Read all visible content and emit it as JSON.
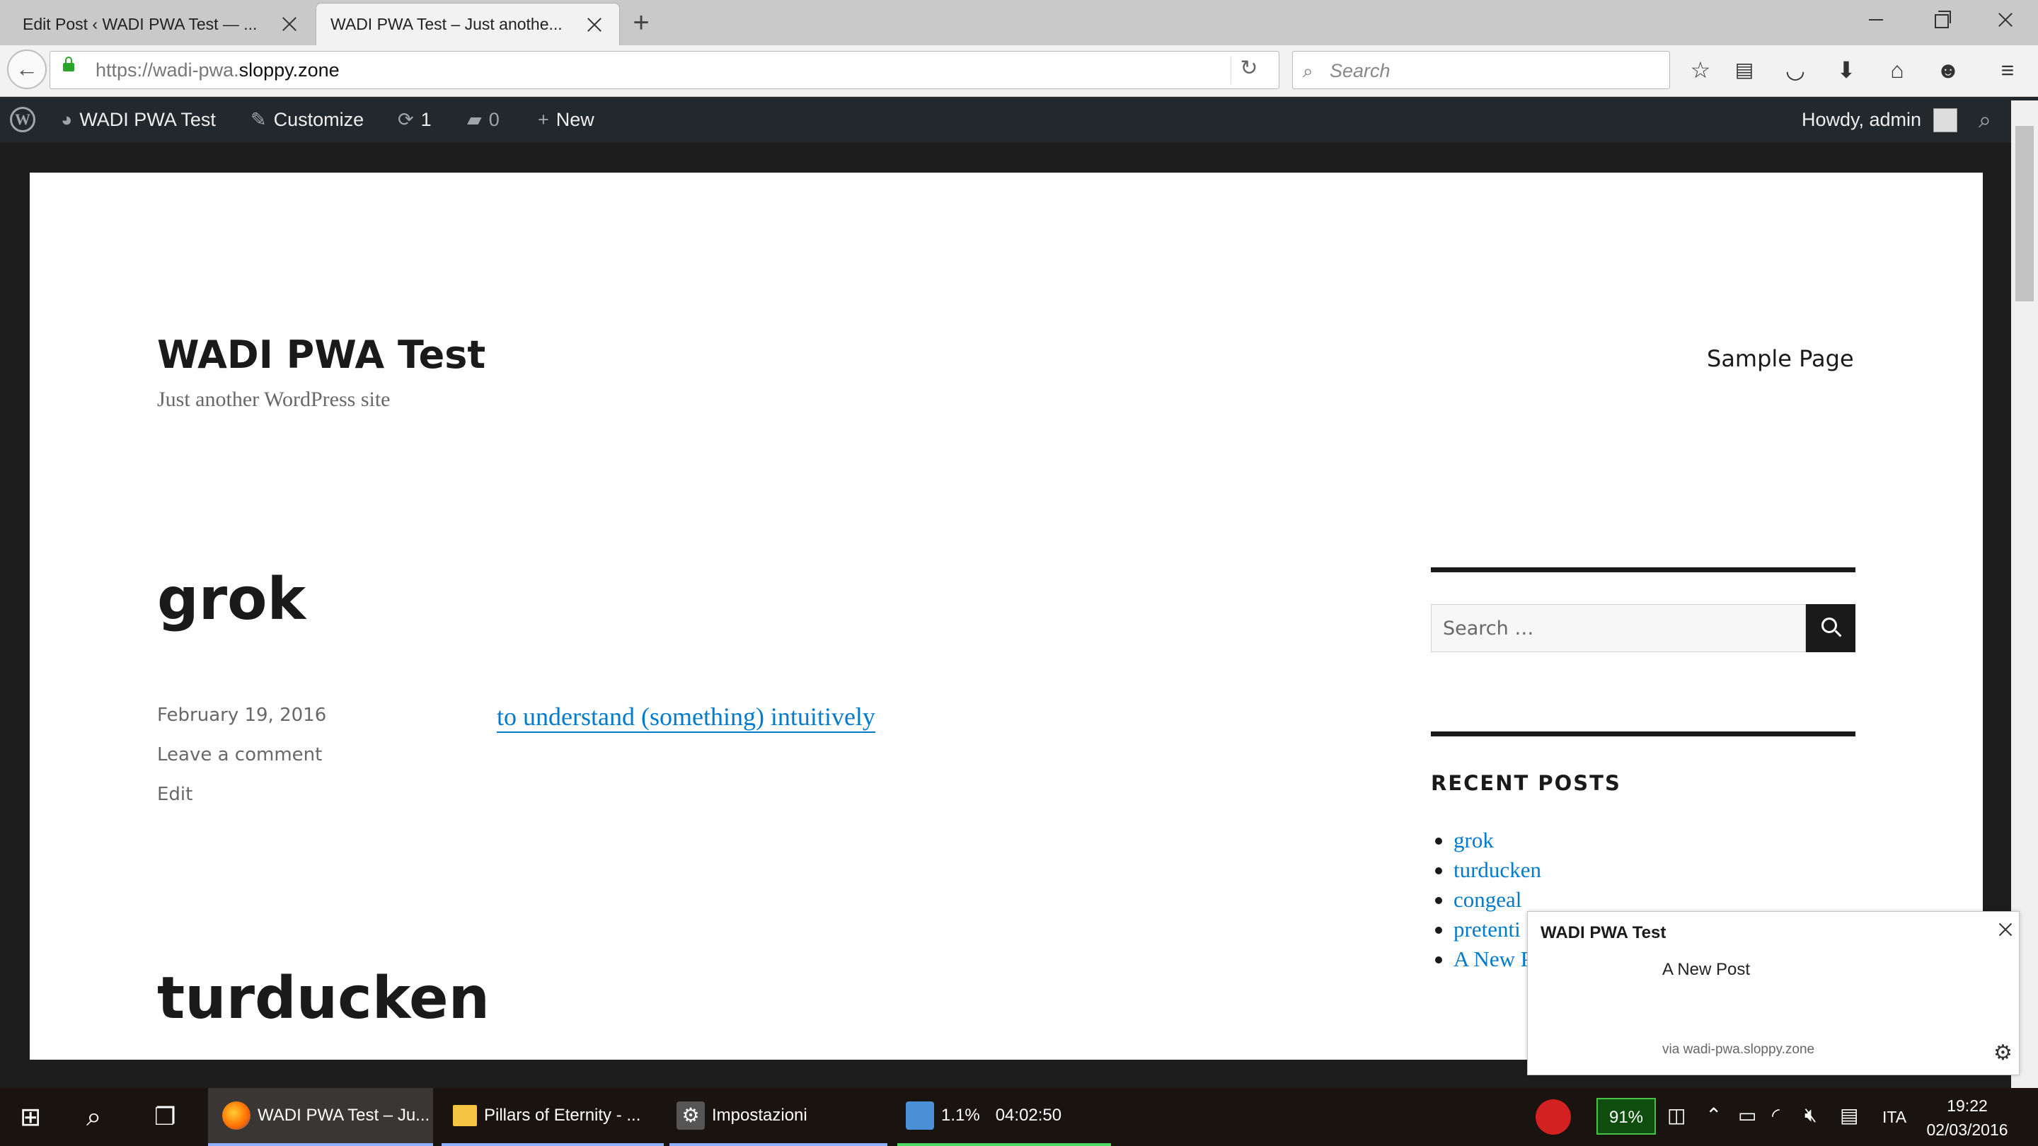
{
  "browser": {
    "tabs": [
      {
        "title": "Edit Post ‹ WADI PWA Test — ...",
        "active": false
      },
      {
        "title": "WADI PWA Test – Just anothe...",
        "active": true
      }
    ],
    "url_prefix": "https://wadi-pwa.",
    "url_domain": "sloppy.zone",
    "search_placeholder": "Search"
  },
  "adminbar": {
    "site": "WADI PWA Test",
    "customize": "Customize",
    "updates": "1",
    "comments": "0",
    "new": "New",
    "howdy": "Howdy, admin"
  },
  "site": {
    "title": "WADI PWA Test",
    "description": "Just another WordPress site",
    "menu": [
      "Sample Page"
    ]
  },
  "posts": [
    {
      "title": "grok",
      "date": "February 19, 2016",
      "comment_link": "Leave a comment",
      "edit_link": "Edit",
      "excerpt": "to understand (something) intuitively"
    },
    {
      "title": "turducken"
    }
  ],
  "sidebar": {
    "search_placeholder": "Search …",
    "recent_posts_heading": "RECENT POSTS",
    "recent_posts": [
      "grok",
      "turducken",
      "congeal",
      "pretenti",
      "A New P"
    ]
  },
  "notification": {
    "title": "WADI PWA Test",
    "body": "A New Post",
    "via": "via wadi-pwa.sloppy.zone"
  },
  "taskbar": {
    "apps": [
      {
        "label": "WADI PWA Test – Ju..."
      },
      {
        "label": "Pillars of Eternity - ..."
      },
      {
        "label": "Impostazioni"
      }
    ],
    "monitor": {
      "cpu": "1.1%",
      "time": "04:02:50"
    },
    "battery": "91%",
    "language": "ITA",
    "clock_time": "19:22",
    "clock_date": "02/03/2016"
  },
  "colors": {
    "link": "#007acc",
    "adminbar": "#23282d",
    "text": "#1a1a1a"
  }
}
